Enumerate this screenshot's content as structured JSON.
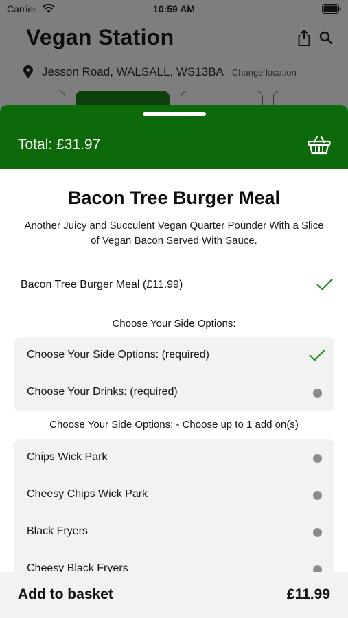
{
  "status_bar": {
    "carrier": "Carrier",
    "time": "10:59 AM"
  },
  "store": {
    "title": "Vegan Station",
    "address": "Jesson Road, WALSALL, WS13BA",
    "change_location": "Change location"
  },
  "sheet": {
    "total": "Total: £31.97",
    "accent_color": "#0c6a0b"
  },
  "product": {
    "title": "Bacon Tree Burger Meal",
    "description": "Another Juicy and Succulent Vegan Quarter Pounder With a Slice of Vegan  Bacon Served With Sauce.",
    "main_option": "Bacon Tree Burger Meal (£11.99)"
  },
  "sections": {
    "side_options_title": "Choose Your Side Options:",
    "required_rows": [
      {
        "label": "Choose Your Side Options: (required)",
        "state": "checked"
      },
      {
        "label": "Choose Your Drinks: (required)",
        "state": "unchecked"
      }
    ],
    "addons_title": "Choose Your Side Options: - Choose up to 1 add on(s)",
    "addon_rows": [
      {
        "label": "Chips Wick Park"
      },
      {
        "label": "Cheesy Chips Wick Park"
      },
      {
        "label": "Black Fryers"
      },
      {
        "label": "Cheesy Black Fryers"
      }
    ]
  },
  "footer": {
    "add_label": "Add to basket",
    "price": "£11.99"
  }
}
